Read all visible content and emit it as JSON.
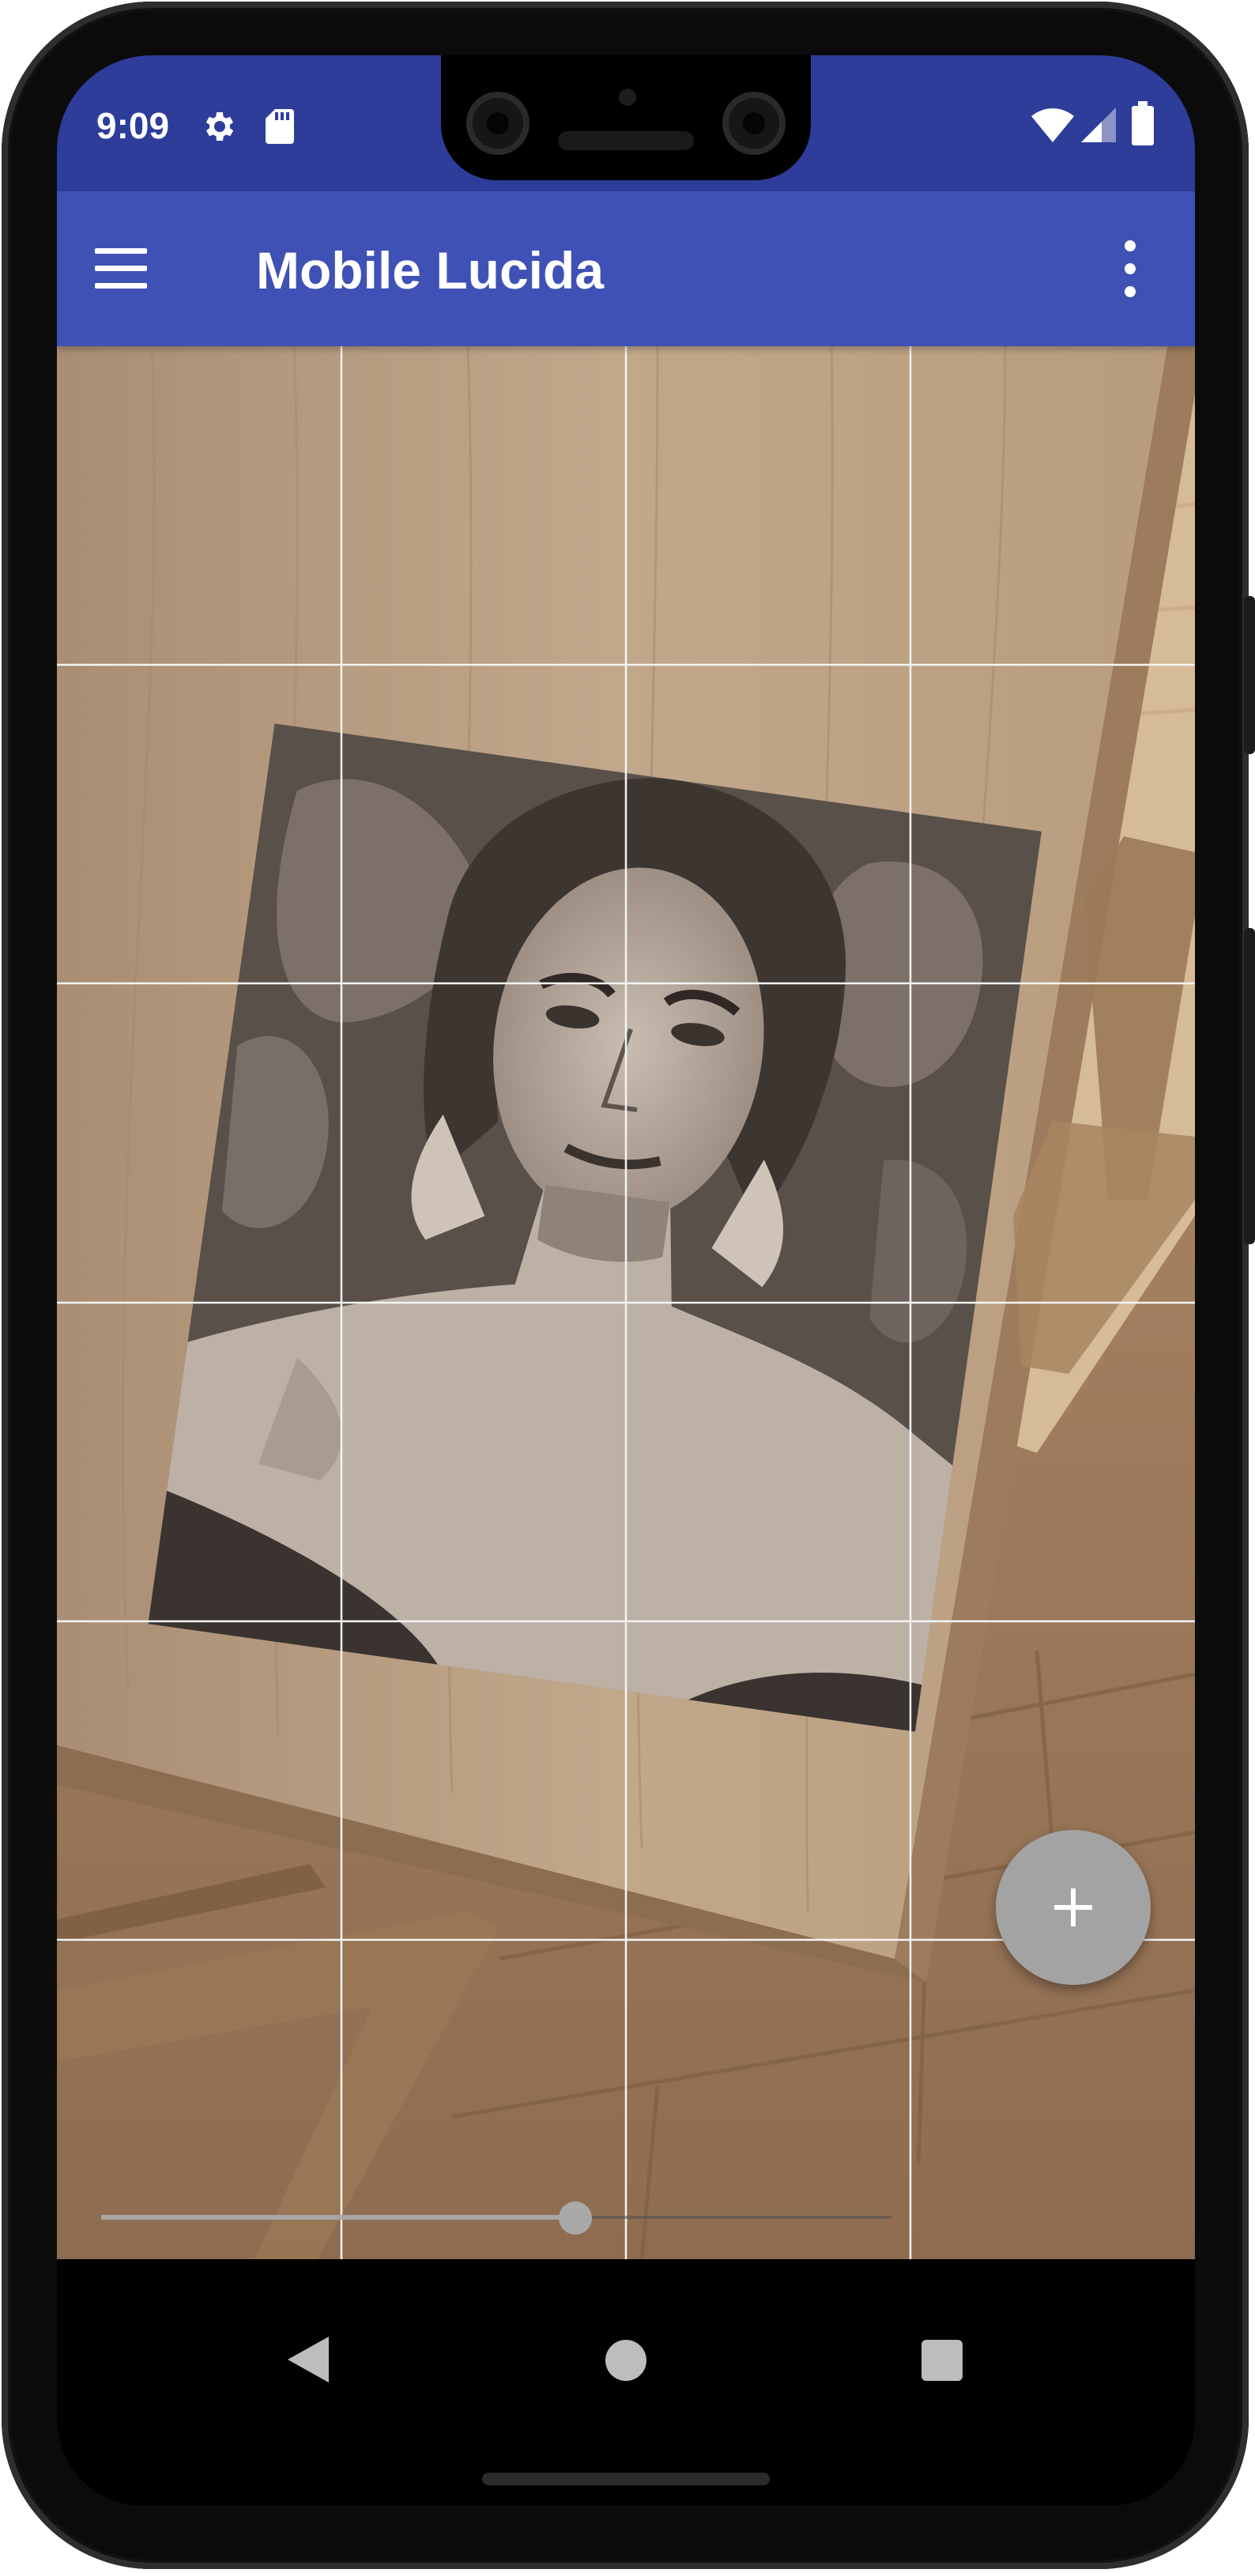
{
  "status_bar": {
    "time": "9:09",
    "left_icons": [
      "settings-icon",
      "sd-card-icon"
    ],
    "right_icons": [
      "wifi-icon",
      "cell-signal-icon",
      "battery-icon"
    ],
    "background": "#2e3d9a"
  },
  "app_bar": {
    "title": "Mobile Lucida",
    "menu_icon": "hamburger-menu-icon",
    "overflow_icon": "more-vert-icon",
    "background": "#3f51b5"
  },
  "camera_view": {
    "content": "traced photo overlay on wooden table",
    "grid": {
      "columns": 4,
      "rows": 6,
      "line_color": "#ffffff"
    }
  },
  "opacity_slider": {
    "value": 0.6
  },
  "fab": {
    "icon": "add-icon",
    "color": "#a3a3a3"
  },
  "nav_bar": {
    "buttons": [
      "back-icon",
      "home-icon",
      "recents-icon"
    ]
  }
}
